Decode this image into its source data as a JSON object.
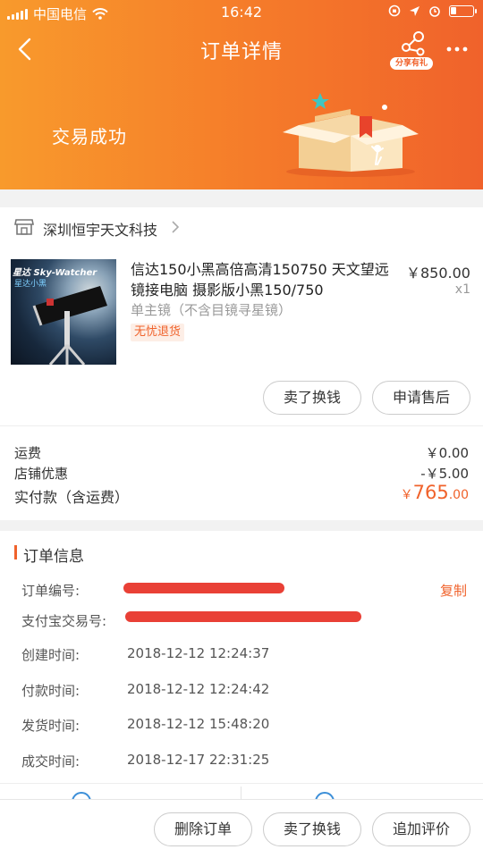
{
  "status_bar": {
    "carrier": "中国电信",
    "time": "16:42"
  },
  "nav": {
    "title": "订单详情",
    "share_label": "分享有礼"
  },
  "hero": {
    "status_text": "交易成功"
  },
  "shop": {
    "name": "深圳恒宇天文科技"
  },
  "product": {
    "thumb_brand": "星达 Sky-Watcher",
    "thumb_sub": "星达小黑",
    "title": "信达150小黑高倍高清150750 天文望远镜接电脑 摄影版小黑150/750",
    "price": "￥850.00",
    "quantity": "x1",
    "sku": "单主镜（不含目镜寻星镜）",
    "tag": "无忧退货",
    "btn_resell": "卖了换钱",
    "btn_aftersale": "申请售后"
  },
  "fees": {
    "shipping_label": "运费",
    "shipping_value": "￥0.00",
    "discount_label": "店铺优惠",
    "discount_value": "-￥5.00",
    "total_label": "实付款（含运费）",
    "total_yen": "￥",
    "total_int": "765",
    "total_dec": ".00"
  },
  "order_info": {
    "section_title": "订单信息",
    "order_no_label": "订单编号:",
    "copy_label": "复制",
    "alipay_label": "支付宝交易号:",
    "created_label": "创建时间:",
    "created_value": "2018-12-12 12:24:37",
    "paid_label": "付款时间:",
    "paid_value": "2018-12-12 12:24:42",
    "shipped_label": "发货时间:",
    "shipped_value": "2018-12-12 15:48:20",
    "closed_label": "成交时间:",
    "closed_value": "2018-12-17 22:31:25"
  },
  "bottom_bar": {
    "delete": "删除订单",
    "resell": "卖了换钱",
    "review": "追加评价"
  },
  "colors": {
    "accent": "#f0622b",
    "header_start": "#f89a2c",
    "header_end": "#f0622b"
  }
}
